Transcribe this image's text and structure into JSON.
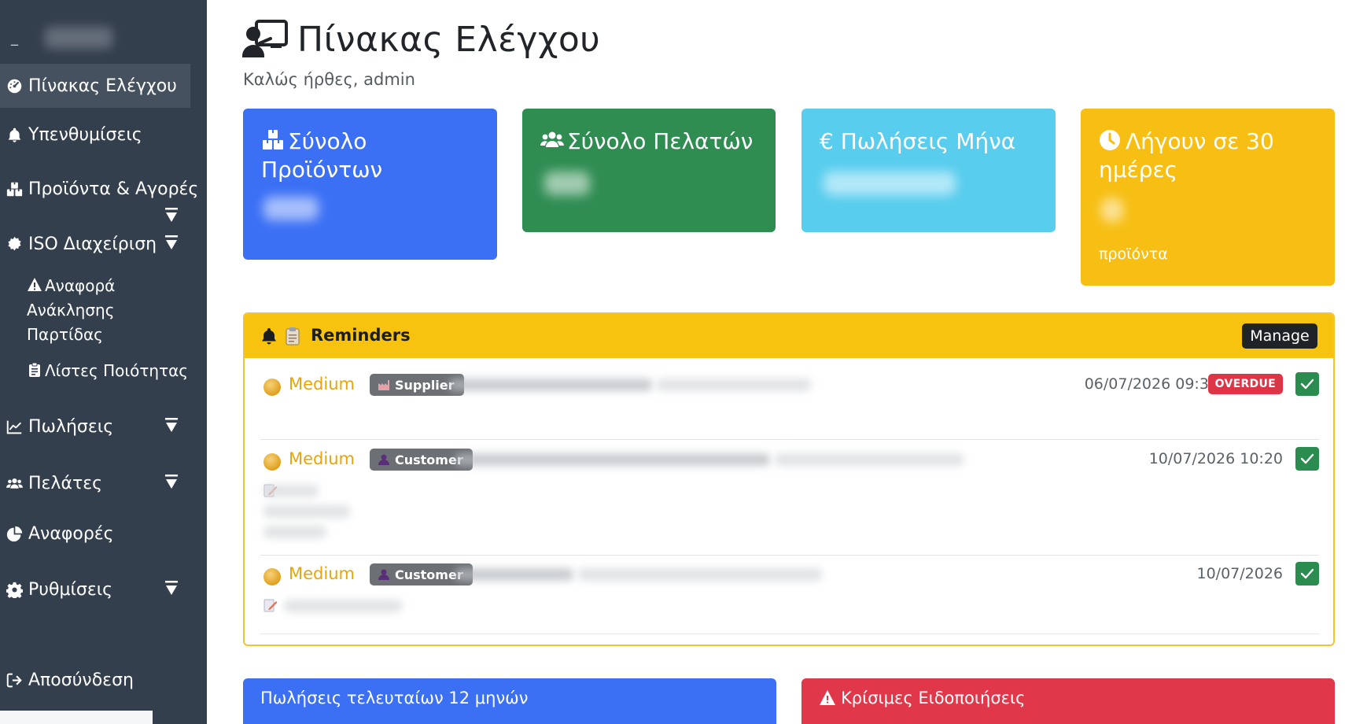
{
  "sidebar": {
    "brand_dash": "_",
    "items": [
      {
        "label": "Πίνακας Ελέγχου",
        "icon": "dashboard-icon"
      },
      {
        "label": "Υπενθυμίσεις",
        "icon": "bell-icon"
      },
      {
        "label": "Προϊόντα & Αγορές",
        "icon": "boxes-icon"
      },
      {
        "label": "ISO Διαχείριση",
        "icon": "certificate-icon"
      },
      {
        "label": "Αναφορά Ανάκλησης Παρτίδας",
        "icon": "warning-icon"
      },
      {
        "label": "Λίστες Ποιότητας",
        "icon": "clipboard-icon"
      },
      {
        "label": "Πωλήσεις",
        "icon": "chart-line-icon"
      },
      {
        "label": "Πελάτες",
        "icon": "users-icon"
      },
      {
        "label": "Αναφορές",
        "icon": "pie-chart-icon"
      },
      {
        "label": "Ρυθμίσεις",
        "icon": "gear-icon"
      },
      {
        "label": "Αποσύνδεση",
        "icon": "logout-icon"
      }
    ]
  },
  "header": {
    "title": "Πίνακας Ελέγχου",
    "welcome": "Καλώς ήρθες, admin"
  },
  "cards": {
    "products": {
      "title": "Σύνολο Προϊόντων",
      "color": "#3b70f5"
    },
    "customers": {
      "title": "Σύνολο Πελατών",
      "color": "#2f8d52"
    },
    "sales": {
      "title": "€ Πωλήσεις Μήνα",
      "color": "#58cdee"
    },
    "expiring": {
      "title": "Λήγουν σε 30 ημέρες",
      "subtitle": "προϊόντα",
      "color": "#f7bf13"
    }
  },
  "reminders": {
    "title": "Reminders",
    "manage_label": "Manage",
    "rows": [
      {
        "priority": "Medium",
        "tag": "Supplier",
        "datetime": "06/07/2026 09:30",
        "badge": "OVERDUE"
      },
      {
        "priority": "Medium",
        "tag": "Customer",
        "datetime": "10/07/2026 10:20"
      },
      {
        "priority": "Medium",
        "tag": "Customer",
        "datetime": "10/07/2026"
      }
    ]
  },
  "bottom": {
    "sales_chart_title": "Πωλήσεις τελευταίων 12 μηνών",
    "alerts_title": "Κρίσιμες Ειδοποιήσεις"
  },
  "colors": {
    "sidebar_bg": "#343f4e",
    "warning": "#f7c30e",
    "danger": "#dc3545",
    "success": "#2a8c4f"
  }
}
